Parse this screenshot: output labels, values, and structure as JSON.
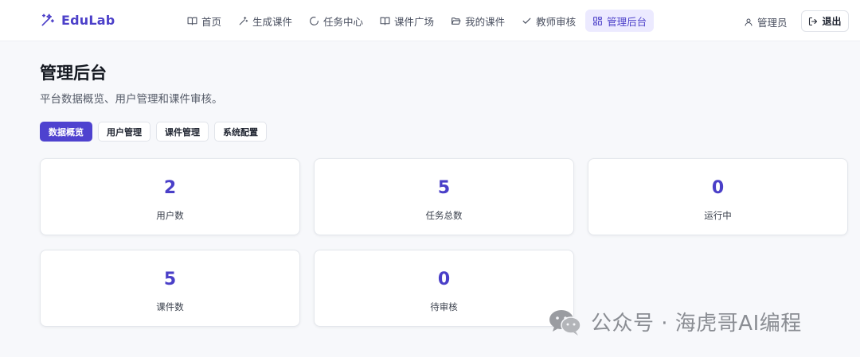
{
  "brand": {
    "name": "EduLab"
  },
  "nav": {
    "items": [
      {
        "label": "首页",
        "icon": "book-open-icon",
        "active": false
      },
      {
        "label": "生成课件",
        "icon": "magic-wand-icon",
        "active": false
      },
      {
        "label": "任务中心",
        "icon": "loader-circle-icon",
        "active": false
      },
      {
        "label": "课件广场",
        "icon": "book-open-icon",
        "active": false
      },
      {
        "label": "我的课件",
        "icon": "folder-open-icon",
        "active": false
      },
      {
        "label": "教师审核",
        "icon": "check-icon",
        "active": false
      },
      {
        "label": "管理后台",
        "icon": "grid-icon",
        "active": true
      }
    ],
    "user_label": "管理员",
    "logout_label": "退出"
  },
  "page": {
    "title": "管理后台",
    "subtitle": "平台数据概览、用户管理和课件审核。"
  },
  "tabs": [
    {
      "label": "数据概览",
      "active": true
    },
    {
      "label": "用户管理",
      "active": false
    },
    {
      "label": "课件管理",
      "active": false
    },
    {
      "label": "系统配置",
      "active": false
    }
  ],
  "stats": [
    {
      "value": "2",
      "label": "用户数"
    },
    {
      "value": "5",
      "label": "任务总数"
    },
    {
      "value": "0",
      "label": "运行中"
    },
    {
      "value": "5",
      "label": "课件数"
    },
    {
      "value": "0",
      "label": "待审核"
    }
  ],
  "watermark": {
    "text": "公众号 · 海虎哥AI编程"
  },
  "colors": {
    "accent": "#4e42cf",
    "accent_soft": "#eceaff",
    "background": "#f7f8fb",
    "stat_number": "#4a3fc8"
  }
}
